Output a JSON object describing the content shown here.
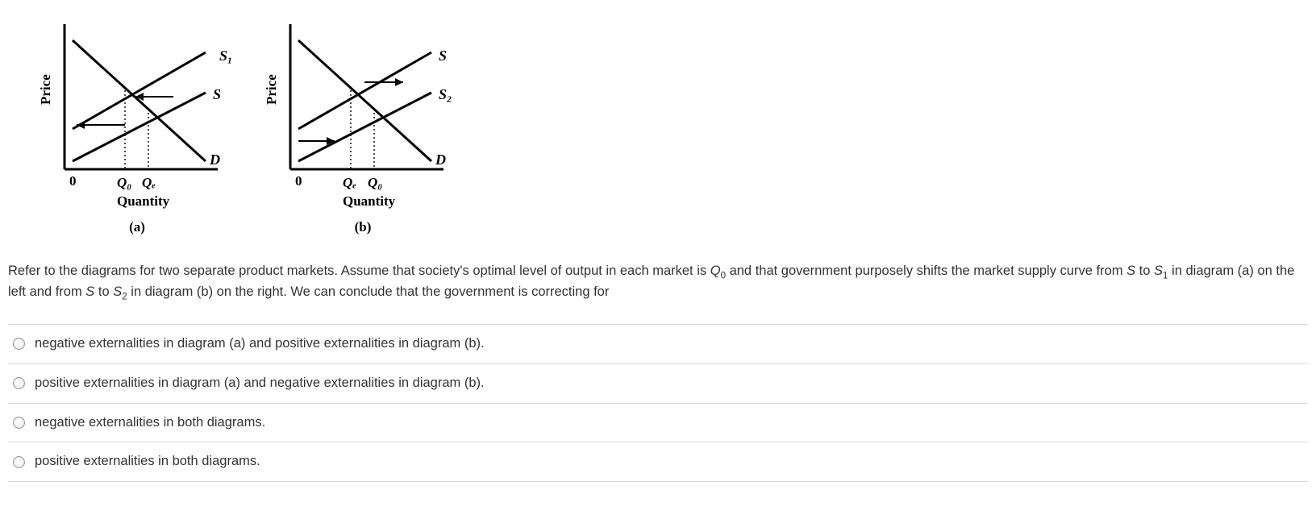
{
  "diagrams": {
    "a": {
      "y_axis": "Price",
      "x_axis": "Quantity",
      "origin": "0",
      "curves": {
        "s1": "S₁",
        "s": "S",
        "d": "D"
      },
      "ticks": {
        "q0": "Q₀",
        "qe": "Qₑ"
      },
      "caption": "(a)"
    },
    "b": {
      "y_axis": "Price",
      "x_axis": "Quantity",
      "origin": "0",
      "curves": {
        "s": "S",
        "s2": "S₂",
        "d": "D"
      },
      "ticks": {
        "qe": "Qₑ",
        "q0": "Q₀"
      },
      "caption": "(b)"
    }
  },
  "question_html": "Refer to the diagrams for two separate product markets. Assume that society's optimal level of output in each market is <span class='it'>Q</span><sub>0</sub> and that government purposely shifts the market supply curve from <span class='it'>S</span> to <span class='it'>S</span><sub>1</sub> in diagram (a) on the left and from <span class='it'>S</span> to <span class='it'>S</span><sub>2</sub> in diagram (b) on the right. We can conclude that the government is correcting for",
  "options": [
    "negative externalities in diagram (a) and positive externalities in diagram (b).",
    "positive externalities in diagram (a) and negative externalities in diagram (b).",
    "negative externalities in both diagrams.",
    "positive externalities in both diagrams."
  ],
  "chart_data": [
    {
      "type": "line",
      "title": "(a)",
      "xlabel": "Quantity",
      "ylabel": "Price",
      "series": [
        {
          "name": "D",
          "description": "Demand — downward sloping"
        },
        {
          "name": "S",
          "description": "Original supply — upward sloping"
        },
        {
          "name": "S₁",
          "description": "Shifted supply — upward sloping, left of S"
        }
      ],
      "verticals": [
        "Q₀",
        "Qₑ"
      ],
      "shift_direction": "left (arrow points leftward)",
      "intersections": {
        "S∩D": "Qₑ",
        "S₁∩D": "Q₀"
      }
    },
    {
      "type": "line",
      "title": "(b)",
      "xlabel": "Quantity",
      "ylabel": "Price",
      "series": [
        {
          "name": "D",
          "description": "Demand — downward sloping"
        },
        {
          "name": "S",
          "description": "Original supply — upward sloping"
        },
        {
          "name": "S₂",
          "description": "Shifted supply — upward sloping, right of S"
        }
      ],
      "verticals": [
        "Qₑ",
        "Q₀"
      ],
      "shift_direction": "right (arrow points rightward)",
      "intersections": {
        "S∩D": "Qₑ",
        "S₂∩D": "Q₀"
      }
    }
  ]
}
